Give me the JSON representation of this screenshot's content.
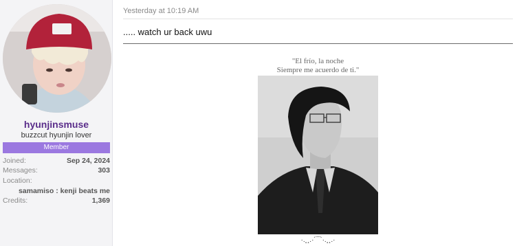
{
  "user": {
    "username": "hyunjinsmuse",
    "user_title": "buzzcut hyunjin lover",
    "badge": "Member",
    "stats": {
      "joined_label": "Joined:",
      "joined_value": "Sep 24, 2024",
      "messages_label": "Messages:",
      "messages_value": "303",
      "location_label": "Location:",
      "location_value": "samamiso : kenji beats me",
      "credits_label": "Credits:",
      "credits_value": "1,369"
    }
  },
  "post": {
    "timestamp": "Yesterday at 10:19 AM",
    "message": "..... watch ur back uwu",
    "quote_line1": "\"El frío, la noche",
    "quote_line2": "Siempre me acuerdo de ti.\"",
    "footer_decoration": "·.¸¸.·´¯`·.¸¸.·"
  },
  "colors": {
    "username": "#5a2d8a",
    "badge_bg": "#9b78e0",
    "panel_bg": "#f4f4f6"
  }
}
